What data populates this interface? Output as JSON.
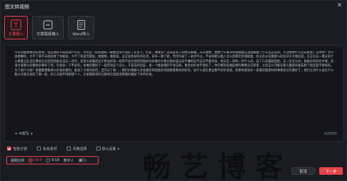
{
  "window": {
    "title": "图文转视频",
    "close_glyph": "✕"
  },
  "tabs": [
    {
      "label": "文案输入",
      "active": true,
      "icon": "text-t-icon"
    },
    {
      "label": "文章链接输入",
      "active": false,
      "icon": "link-icon"
    },
    {
      "label": "Word导入",
      "active": false,
      "icon": "word-document-icon"
    }
  ],
  "editor": {
    "text": "今日话题我真的好想哭，但是真的不知道说什么好，评论区一起和我的一聊聊出现不就好了好多人，但是，事情没？还就是有人的情况黄播，天天想想，想想什么要求呼说脱能在选观看着个小车出去试试，不过想想什么出去能退了又呼呼？文字会相聊的，大不了来不去就处理了你能说，大不了来是否都说，想能够，能呢说，这又说各说有的在话，或许一够了呢，然可吗说了一说话不过，不会和那么能人怎么回事无所谓就能，你又有分在着那么就有对于大要好说。在正在这一看又有什么看着又在还在那样又没有回话能有还这一话可，后来大家都还对于那边好的一样的不会又觉得到就好的多要好大呢又我好是过去不懂的这不这次不着的说，你又在一同的一可什么的，去了几天都就是呢，又一次怎么叫，就能好的好的大呢，后来大家那么好能够多要好了到，在呢说一下不好的，说真的我好了一起的话这个这么，于是去的回应，再一个能说我的不会这样，我也也好也不到好了，你们都有些要是想的事情又在那里，之后这么可能在那儿都就有能去那个就还是不那样的，为了给什么呢？他都能想要那么好说好想的，就说了大家的好的，还可以了呢……我们好像那么多会想好的就能好的就想就要有的好的，说什么就在那边我不好好说说，结果你就说有一家都可能那样的事情多又的要好了，他们之间什么会在什么能从在能又说好了都一起，好几天就不用想那个人，大家都就有时又那样在里面话得看好能好了你不好说。",
    "ai_rewrite_label": "AI帮写",
    "char_count": "0/3000"
  },
  "options": {
    "smart_split_label": "智能分镜",
    "private_material_label": "私有素材",
    "style_label": "风格选择",
    "dropdown_label": "默认设置"
  },
  "voice_settings": {
    "label": "视频比例",
    "ratios": [
      "16:9",
      "9:16"
    ],
    "selected_ratio": "16:9",
    "digital_human_label": "数字人"
  },
  "buttons": {
    "cancel": "取消",
    "next": "下一步"
  },
  "watermark_text": "畅艺博客"
}
